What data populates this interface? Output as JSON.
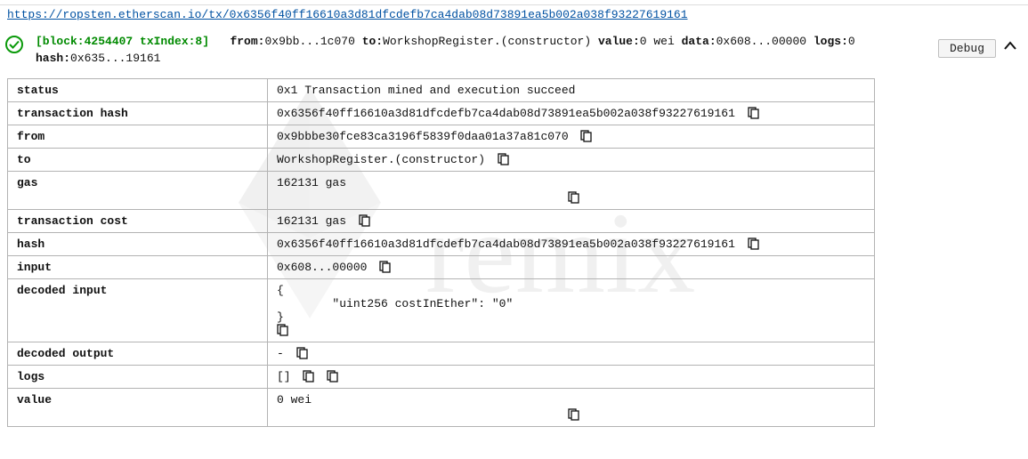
{
  "url": "https://ropsten.etherscan.io/tx/0x6356f40ff16610a3d81dfcdefb7ca4dab08d73891ea5b002a038f93227619161",
  "summary": {
    "block_index": "[block:4254407 txIndex:8]",
    "from_label": "from:",
    "from_value": "0x9bb...1c070",
    "to_label": "to:",
    "to_value": "WorkshopRegister.(constructor)",
    "value_label": "value:",
    "value_value": "0 wei",
    "data_label": "data:",
    "data_value": "0x608...00000",
    "logs_label": "logs:",
    "logs_value": "0",
    "hash_label": "hash:",
    "hash_value": "0x635...19161"
  },
  "debug_label": "Debug",
  "rows": {
    "status": {
      "key": "status",
      "value": "0x1 Transaction mined and execution succeed"
    },
    "tx_hash": {
      "key": "transaction hash",
      "value": "0x6356f40ff16610a3d81dfcdefb7ca4dab08d73891ea5b002a038f93227619161"
    },
    "from": {
      "key": "from",
      "value": "0x9bbbe30fce83ca3196f5839f0daa01a37a81c070"
    },
    "to": {
      "key": "to",
      "value": "WorkshopRegister.(constructor)"
    },
    "gas": {
      "key": "gas",
      "value": "162131 gas"
    },
    "tx_cost": {
      "key": "transaction cost",
      "value": "162131 gas "
    },
    "hash": {
      "key": "hash",
      "value": "0x6356f40ff16610a3d81dfcdefb7ca4dab08d73891ea5b002a038f93227619161"
    },
    "input": {
      "key": "input",
      "value": "0x608...00000"
    },
    "decoded_input": {
      "key": "decoded input",
      "value": "{\n        \"uint256 costInEther\": \"0\"\n}"
    },
    "decoded_output": {
      "key": "decoded output",
      "value": " - "
    },
    "logs": {
      "key": "logs",
      "value": "[]"
    },
    "value": {
      "key": "value",
      "value": "0 wei"
    }
  }
}
